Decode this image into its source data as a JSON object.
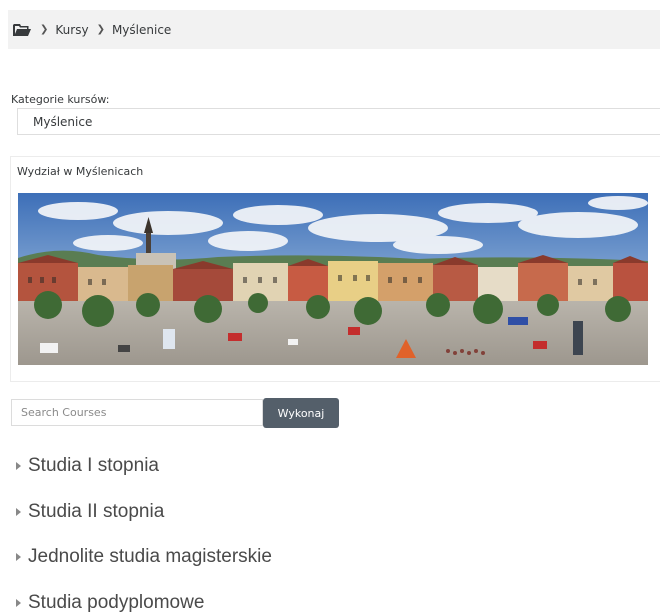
{
  "breadcrumb": {
    "home_icon": "folder-open-icon",
    "items": [
      "Kursy",
      "Myślenice"
    ]
  },
  "category": {
    "label": "Kategorie kursów:",
    "selected": "Myślenice"
  },
  "info": {
    "title": "Wydział w Myślenicach"
  },
  "search": {
    "placeholder": "Search Courses",
    "button": "Wykonaj"
  },
  "categories": [
    "Studia I stopnia",
    "Studia II stopnia",
    "Jednolite studia magisterskie",
    "Studia podyplomowe"
  ],
  "colors": {
    "breadcrumb_bg": "#f2f2f2",
    "button_bg": "#545f6a",
    "text": "#373a3c"
  }
}
